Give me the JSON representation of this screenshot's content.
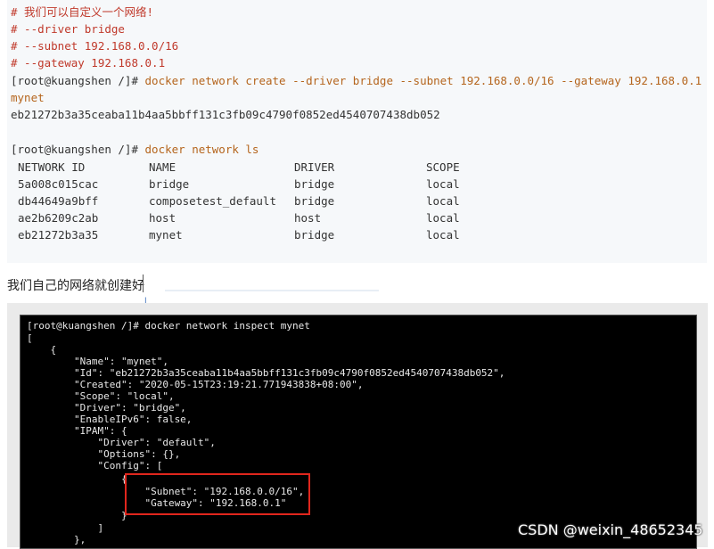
{
  "code": {
    "comments": [
      "# 我们可以自定义一个网络!",
      "# --driver bridge",
      "# --subnet 192.168.0.0/16",
      "# --gateway 192.168.0.1"
    ],
    "create_prompt": "[root@kuangshen /]# ",
    "create_cmd": "docker network create --driver bridge --subnet 192.168.0.0/16 --gateway 192.168.0.1",
    "create_cmd_cont": "mynet",
    "create_output": "eb21272b3a35ceaba11b4aa5bbff131c3fb09c4790f0852ed4540707438db052",
    "ls_prompt": "[root@kuangshen /]# ",
    "ls_cmd": "docker network ls",
    "table": {
      "headers": [
        "NETWORK ID",
        "NAME",
        "DRIVER",
        "SCOPE"
      ],
      "rows": [
        [
          "5a008c015cac",
          "bridge",
          "bridge",
          "local"
        ],
        [
          "db44649a9bff",
          "composetest_default",
          "bridge",
          "local"
        ],
        [
          "ae2b6209c2ab",
          "host",
          "host",
          "local"
        ],
        [
          "eb21272b3a35",
          "mynet",
          "bridge",
          "local"
        ]
      ]
    }
  },
  "paragraph": "我们自己的网络就创建好",
  "cursor_mark": "I",
  "terminal": {
    "lines": [
      "[root@kuangshen /]# docker network inspect mynet",
      "[",
      "    {",
      "        \"Name\": \"mynet\",",
      "        \"Id\": \"eb21272b3a35ceaba11b4aa5bbff131c3fb09c4790f0852ed4540707438db052\",",
      "        \"Created\": \"2020-05-15T23:19:21.771943838+08:00\",",
      "        \"Scope\": \"local\",",
      "        \"Driver\": \"bridge\",",
      "        \"EnableIPv6\": false,",
      "        \"IPAM\": {",
      "            \"Driver\": \"default\",",
      "            \"Options\": {},",
      "            \"Config\": [",
      "                {",
      "                    \"Subnet\": \"192.168.0.0/16\",",
      "                    \"Gateway\": \"192.168.0.1\"",
      "                }",
      "            ]",
      "        },"
    ]
  },
  "watermark": "CSDN @weixin_48652345",
  "colors": {
    "comment": "#c0392b",
    "command": "#b5651d",
    "highlight_box": "#e0261d",
    "terminal_bg": "#000000"
  }
}
